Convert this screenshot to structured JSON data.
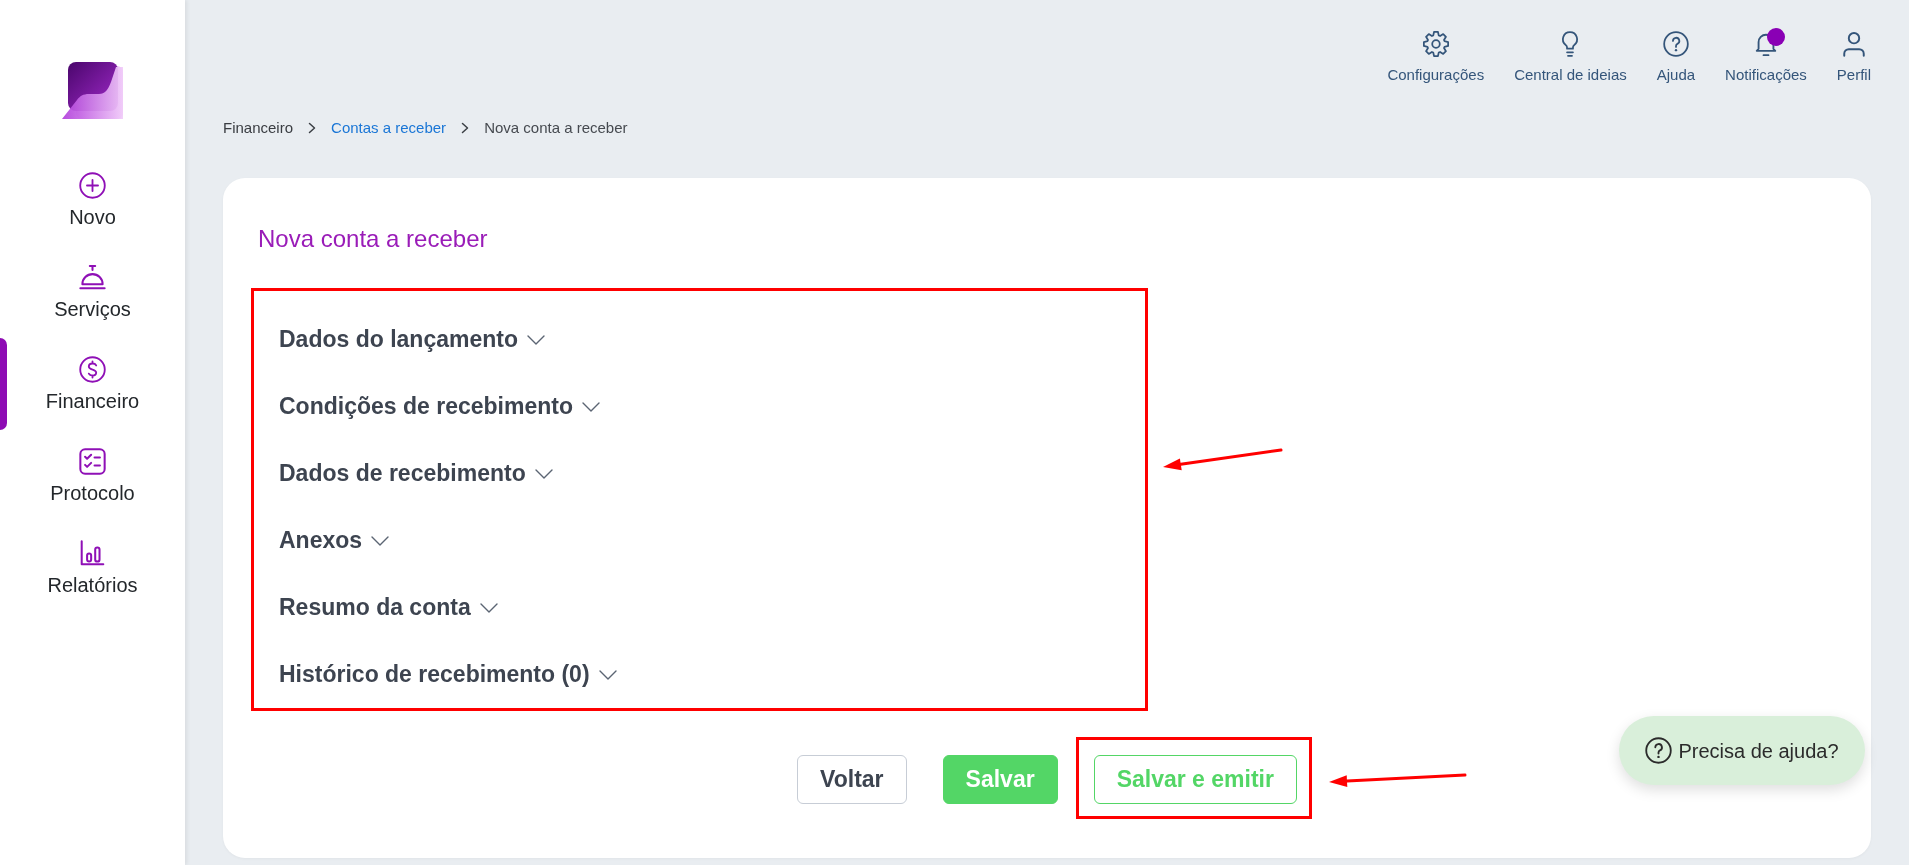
{
  "sidebar": {
    "items": [
      {
        "kind": "new",
        "label": "Novo",
        "selected": false
      },
      {
        "kind": "services",
        "label": "Serviços",
        "selected": false
      },
      {
        "kind": "finance",
        "label": "Financeiro",
        "selected": true
      },
      {
        "kind": "protocol",
        "label": "Protocolo",
        "selected": false
      },
      {
        "kind": "reports",
        "label": "Relatórios",
        "selected": false
      }
    ]
  },
  "top_bar": {
    "items": [
      {
        "kind": "settings",
        "label": "Configurações",
        "unread": false
      },
      {
        "kind": "ideas",
        "label": "Central de ideias",
        "unread": false
      },
      {
        "kind": "help",
        "label": "Ajuda",
        "unread": false
      },
      {
        "kind": "notifications",
        "label": "Notificações",
        "unread": true
      },
      {
        "kind": "profile",
        "label": "Perfil",
        "unread": false
      }
    ]
  },
  "breadcrumb": [
    {
      "kind": "text",
      "label": "Financeiro"
    },
    {
      "kind": "link",
      "label": "Contas a receber"
    },
    {
      "kind": "current",
      "label": "Nova conta a receber"
    }
  ],
  "card": {
    "title": "Nova conta a receber",
    "sections": {
      "highlighted": true,
      "items": [
        {
          "label": "Dados do lançamento",
          "expanded": false
        },
        {
          "label": "Condições de recebimento",
          "expanded": false
        },
        {
          "label": "Dados de recebimento",
          "expanded": false
        },
        {
          "label": "Anexos",
          "expanded": false
        },
        {
          "label": "Resumo da conta",
          "expanded": false
        },
        {
          "label": "Histórico de recebimento (0)",
          "expanded": false
        }
      ]
    },
    "buttons": [
      {
        "kind": "neutral",
        "label": "Voltar",
        "highlighted": false
      },
      {
        "kind": "solid",
        "label": "Salvar",
        "highlighted": false
      },
      {
        "kind": "outline",
        "label": "Salvar e emitir",
        "highlighted": true
      }
    ]
  },
  "help_button": {
    "label": "Precisa de ajuda?"
  }
}
